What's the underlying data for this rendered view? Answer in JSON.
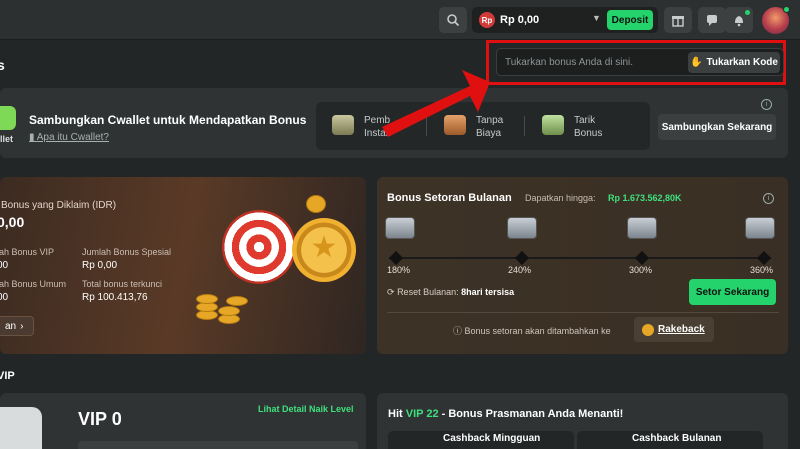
{
  "topbar": {
    "balance_currency": "Rp",
    "balance": "Rp 0,00",
    "deposit_label": "Deposit"
  },
  "section_title": "s",
  "redeem": {
    "placeholder": "Tukarkan bonus Anda di sini.",
    "button": "Tukarkan Kode"
  },
  "cwallet": {
    "logo_label": "llet",
    "title": "Sambungkan Cwallet untuk Mendapatkan Bonus",
    "link": "Apa itu Cwallet?",
    "features": [
      "Pemb\nInstan",
      "Tanpa\nBiaya",
      "Tarik\nBonus"
    ],
    "connect": "Sambungkan Sekarang"
  },
  "bonus_card": {
    "title": "l Bonus yang Diklaim (IDR)",
    "amount": "0,00",
    "vip_label": "lah Bonus VIP",
    "vip_value": "00",
    "special_label": "Jumlah Bonus Spesial",
    "special_value": "Rp 0,00",
    "general_label": "lah Bonus Umum",
    "general_value": "00",
    "locked_label": "Total bonus terkunci",
    "locked_value": "Rp 100.413,76",
    "action": "an"
  },
  "deposit_bonus": {
    "title": "Bonus Setoran Bulanan",
    "sub_label": "Dapatkan hingga:",
    "sub_value": "Rp 1.673.562,80K",
    "tiers": [
      "180%",
      "240%",
      "300%",
      "360%"
    ],
    "reset_label": "Reset Bulanan:",
    "reset_value": "8hari tersisa",
    "button": "Setor Sekarang",
    "note": "Bonus setoran akan ditambahkan ke",
    "rakeback": "Rakeback"
  },
  "vip_section": {
    "title": "VIP",
    "level": "VIP 0",
    "detail_link": "Lihat Detail Naik Level"
  },
  "hit_section": {
    "prefix": "Hit ",
    "vip": "VIP 22",
    "suffix": " - Bonus Prasmanan Anda Menanti!",
    "weekly": "Cashback Mingguan",
    "monthly": "Cashback Bulanan"
  },
  "colors": {
    "accent_green": "#24d36b",
    "highlight_red": "#e01010"
  }
}
